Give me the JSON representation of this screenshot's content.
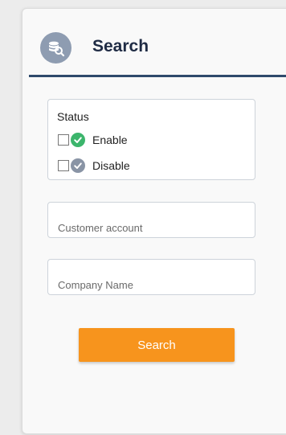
{
  "header": {
    "title": "Search",
    "icon": "database-search-icon",
    "icon_color": "#8e9cb1",
    "rule_color": "#2f4a6c"
  },
  "status": {
    "title": "Status",
    "options": [
      {
        "label": "Enable",
        "checked": false,
        "icon": "check-circle-icon",
        "icon_color": "#3cb56c"
      },
      {
        "label": "Disable",
        "checked": false,
        "icon": "check-circle-icon",
        "icon_color": "#8994a5"
      }
    ]
  },
  "fields": {
    "customer_account": {
      "placeholder": "Customer account",
      "value": ""
    },
    "company_name": {
      "placeholder": "Company Name",
      "value": ""
    }
  },
  "search_button": {
    "label": "Search",
    "color": "#f7941d"
  }
}
